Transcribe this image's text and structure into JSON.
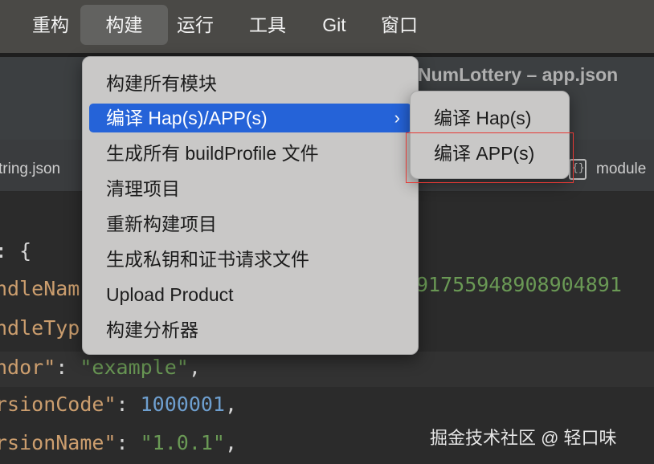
{
  "menubar": {
    "items": [
      "重构",
      "构建",
      "运行",
      "工具",
      "Git",
      "窗口"
    ],
    "active": "构建"
  },
  "window": {
    "title": "NumLottery – app.json"
  },
  "tabs": {
    "left": "tring.json",
    "right": "module"
  },
  "build_menu": {
    "items": [
      "构建所有模块",
      "编译 Hap(s)/APP(s)",
      "生成所有 buildProfile 文件",
      "清理项目",
      "重新构建项目",
      "生成私钥和证书请求文件",
      "Upload Product",
      "构建分析器"
    ],
    "selected_index": 1,
    "submenu_chevron": "›"
  },
  "submenu": {
    "items": [
      "编译 Hap(s)",
      "编译 APP(s)"
    ],
    "highlighted": "编译 APP(s)"
  },
  "editor": {
    "lines": [
      {
        "key": "",
        "rest": ": {"
      },
      {
        "key": "ndleNam",
        "rest": ""
      },
      {
        "key": "ndleTyp",
        "rest": ""
      },
      {
        "key": "ndor\"",
        "rest": ": ",
        "value": "\"example\"",
        "end": ","
      },
      {
        "key": "rsionCode\"",
        "rest": ": ",
        "value": "1000001",
        "end": ","
      },
      {
        "key": "rsionName\"",
        "rest": ": ",
        "value": "\"1.0.1\"",
        "end": ","
      }
    ],
    "truncated_value": "91755948908904891"
  },
  "watermark": "掘金技术社区 @ 轻口味",
  "colors": {
    "menu_bg": "#c9c8c7",
    "selection": "#2563d8",
    "callout_border": "#e53935",
    "key": "#cc9e6e",
    "string": "#6a9955",
    "number": "#6e9fcf"
  }
}
